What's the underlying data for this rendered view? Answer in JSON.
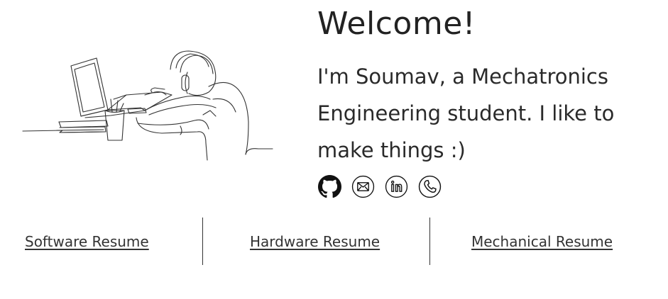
{
  "intro": {
    "heading": "Welcome!",
    "bio": "I'm Soumav, a Mechatronics Engineering student. I like to make things :)"
  },
  "socials": [
    {
      "icon": "github-icon"
    },
    {
      "icon": "email-icon"
    },
    {
      "icon": "linkedin-icon"
    },
    {
      "icon": "phone-icon"
    }
  ],
  "resumes": {
    "software": "Software Resume",
    "hardware": "Hardware Resume",
    "mechanical": "Mechanical Resume"
  },
  "colors": {
    "text": "#222222",
    "line": "#333333",
    "background": "#ffffff"
  }
}
